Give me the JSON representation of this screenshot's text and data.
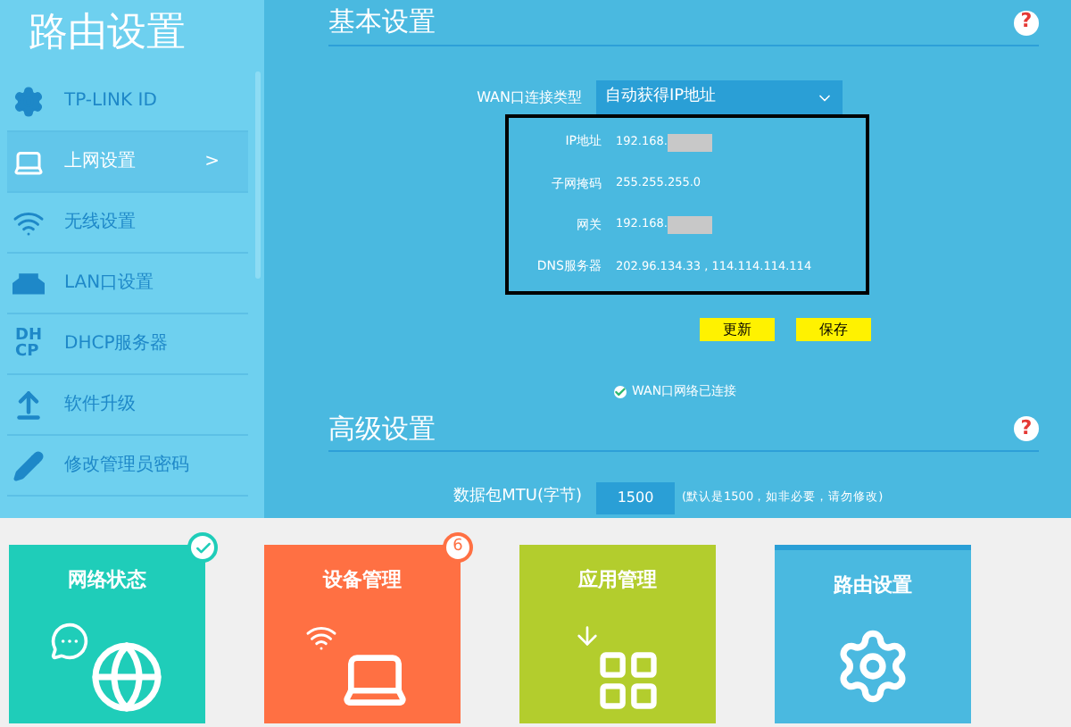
{
  "sidebar": {
    "title": "路由设置",
    "items": [
      {
        "kind": "gear",
        "label": "TP-LINK ID",
        "selected": false
      },
      {
        "kind": "laptop",
        "label": "上网设置",
        "selected": true,
        "arrow": ">"
      },
      {
        "kind": "wifi",
        "label": "无线设置",
        "selected": false
      },
      {
        "kind": "lan",
        "label": "LAN口设置",
        "selected": false
      },
      {
        "kind": "dhcp",
        "label": "DHCP服务器",
        "selected": false,
        "icon_text": [
          "DH",
          "CP"
        ]
      },
      {
        "kind": "upgrade",
        "label": "软件升级",
        "selected": false
      },
      {
        "kind": "pencil",
        "label": "修改管理员密码",
        "selected": false
      }
    ]
  },
  "basic": {
    "title": "基本设置",
    "help": "?",
    "wan_type": {
      "label": "WAN口连接类型",
      "value": "自动获得IP地址"
    },
    "info": [
      {
        "label": "IP地址",
        "value": "192.168.",
        "redacted": true
      },
      {
        "label": "子网掩码",
        "value": "255.255.255.0",
        "redacted": false
      },
      {
        "label": "网关",
        "value": "192.168.",
        "redacted": true
      },
      {
        "label": "DNS服务器",
        "value": "202.96.134.33 , 114.114.114.114",
        "redacted": false
      }
    ],
    "buttons": [
      "更新",
      "保存"
    ],
    "status": "WAN口网络已连接"
  },
  "advanced": {
    "title": "高级设置",
    "help": "?",
    "mtu": {
      "label": "数据包MTU(字节)",
      "value": "1500",
      "hint": "(默认是1500，如非必要，请勿修改)"
    }
  },
  "tiles": [
    {
      "kind": "network",
      "label": "网络状态",
      "color": "#1fcdb9",
      "badge": {
        "kind": "check"
      },
      "selected": false
    },
    {
      "kind": "devices",
      "label": "设备管理",
      "color": "#ff7043",
      "badge": {
        "kind": "count",
        "text": "6"
      },
      "selected": false
    },
    {
      "kind": "apps",
      "label": "应用管理",
      "color": "#b3cd2d",
      "selected": false
    },
    {
      "kind": "router",
      "label": "路由设置",
      "color": "#4ab9e0",
      "selected": true
    }
  ]
}
